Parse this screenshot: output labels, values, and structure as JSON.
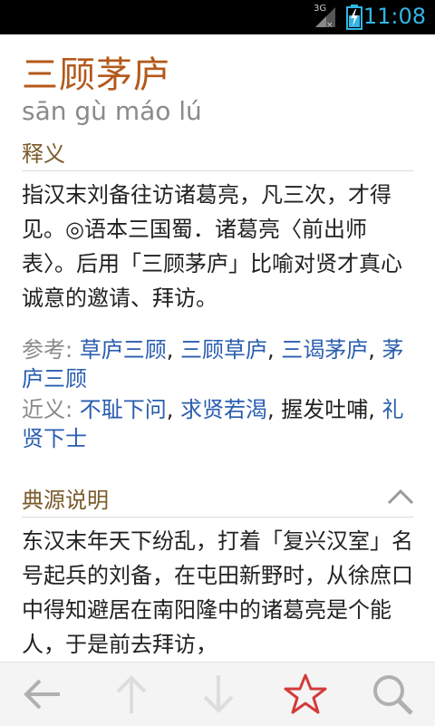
{
  "status_bar": {
    "network_label": "3G",
    "time": "11:08"
  },
  "entry": {
    "title": "三顾茅庐",
    "pinyin": "sān gù máo lú"
  },
  "definition": {
    "header": "释义",
    "text": "指汉末刘备往访诸葛亮，凡三次，才得见。◎语本三国蜀．诸葛亮〈前出师表〉。后用「三顾茅庐」比喻对贤才真心诚意的邀请、拜访。"
  },
  "references": {
    "see_also_label": "参考:",
    "see_also": [
      "草庐三顾",
      "三顾草庐",
      "三谒茅庐",
      "茅庐三顾"
    ],
    "synonyms_label": "近义:",
    "synonyms": [
      {
        "text": "不耻下问",
        "link": true
      },
      {
        "text": "求贤若渴",
        "link": true
      },
      {
        "text": "握发吐哺",
        "link": false
      },
      {
        "text": "礼贤下士",
        "link": true
      }
    ]
  },
  "source": {
    "header": "典源说明",
    "text": "东汉末年天下纷乱，打着「复兴汉室」名号起兵的刘备，在屯田新野时，从徐庶口中得知避居在南阳隆中的诸葛亮是个能人，于是前去拜访，"
  },
  "bottom_bar": {
    "icons": [
      "back-arrow-icon",
      "up-arrow-icon",
      "down-arrow-icon",
      "star-icon",
      "search-icon"
    ],
    "star_color": "#d33a3a"
  },
  "colors": {
    "title": "#b4581a",
    "link": "#2a5db0",
    "status_accent": "#33b5e5"
  }
}
